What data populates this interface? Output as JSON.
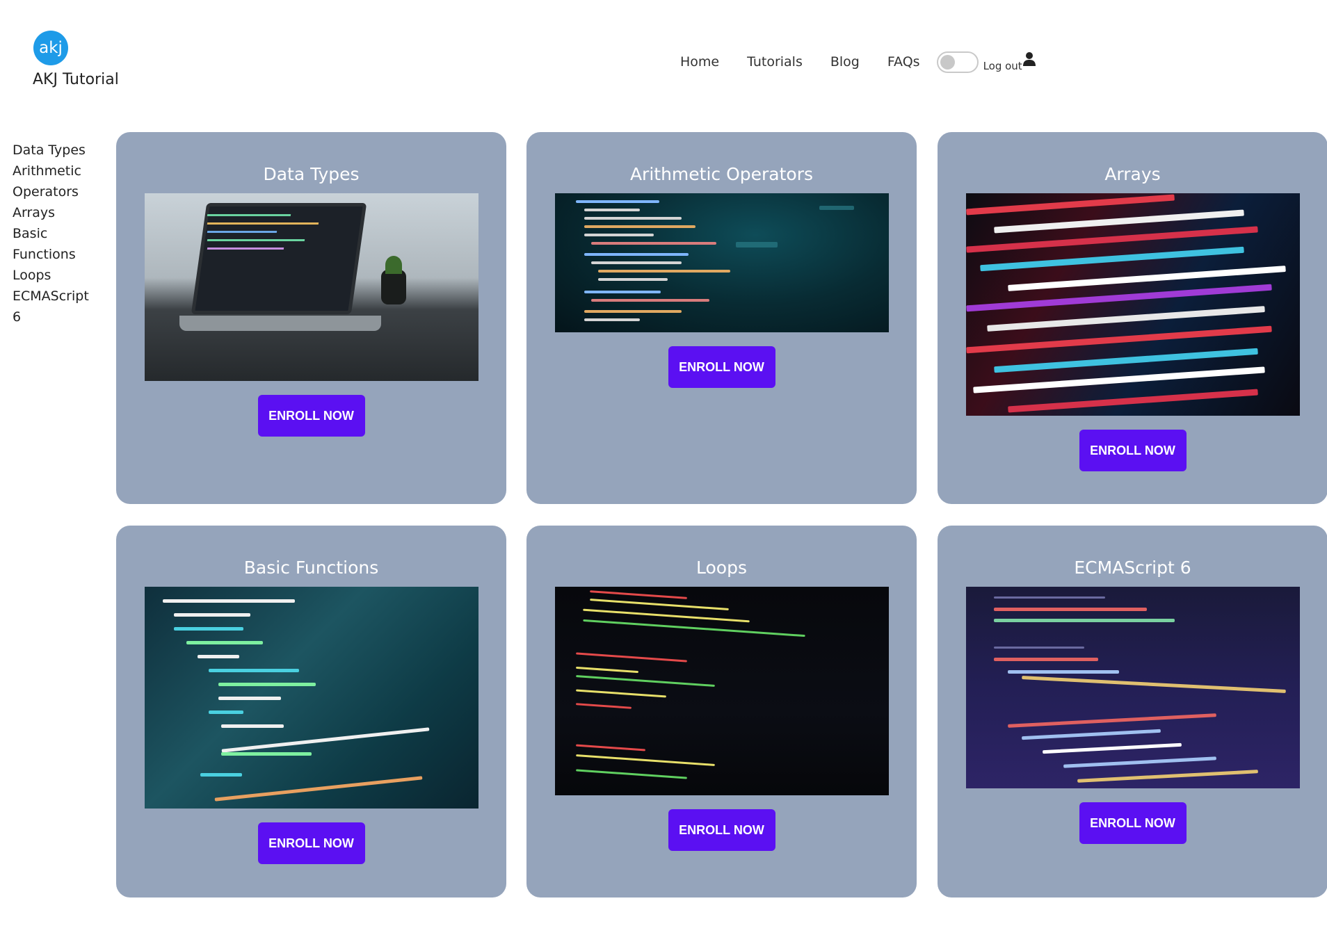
{
  "brand": {
    "logo_text": "akj",
    "name": "AKJ Tutorial"
  },
  "nav": {
    "links": [
      "Home",
      "Tutorials",
      "Blog",
      "FAQs"
    ],
    "logout_label": "Log out"
  },
  "sidebar": {
    "items": [
      "Data Types",
      "Arithmetic",
      "Operators",
      "Arrays",
      "Basic",
      "Functions",
      "Loops",
      "ECMAScript",
      "6"
    ]
  },
  "cards": [
    {
      "title": "Data Types",
      "button": "ENROLL NOW"
    },
    {
      "title": "Arithmetic Operators",
      "button": "ENROLL NOW"
    },
    {
      "title": "Arrays",
      "button": "ENROLL NOW"
    },
    {
      "title": "Basic Functions",
      "button": "ENROLL NOW"
    },
    {
      "title": "Loops",
      "button": "ENROLL NOW"
    },
    {
      "title": "ECMAScript 6",
      "button": "ENROLL NOW"
    }
  ],
  "colors": {
    "card_bg": "#95a4bb",
    "button_bg": "#5b10f2",
    "logo_bg": "#1e9be8"
  },
  "icons": {
    "user": "user-icon"
  }
}
